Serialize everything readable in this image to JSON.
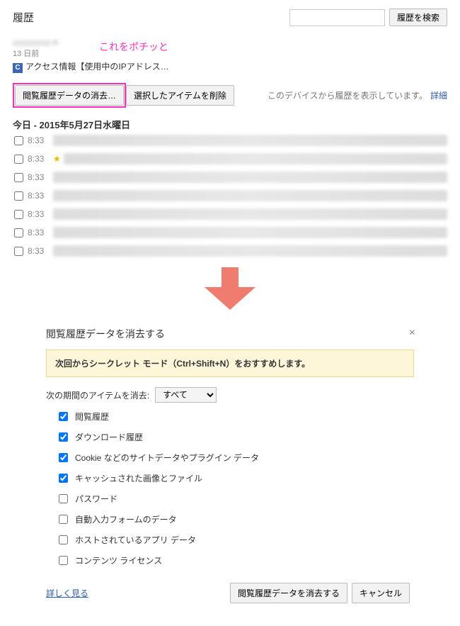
{
  "header": {
    "title": "履歴",
    "search_button": "履歴を検索",
    "search_placeholder": ""
  },
  "annot": {
    "click_this": "これをポチッと"
  },
  "user": {
    "age": "13 日前",
    "access": "アクセス情報【使用中のIPアドレス…",
    "badge": "C"
  },
  "toolbar": {
    "clear": "閲覧履歴データの消去…",
    "delete_selected": "選択したアイテムを削除",
    "device_text": "このデバイスから履歴を表示しています。",
    "details": "詳細"
  },
  "date": "今日 - 2015年5月27日水曜日",
  "history": [
    {
      "time": "8:33",
      "star": false
    },
    {
      "time": "8:33",
      "star": true
    },
    {
      "time": "8:33",
      "star": false
    },
    {
      "time": "8:33",
      "star": false
    },
    {
      "time": "8:33",
      "star": false
    },
    {
      "time": "8:33",
      "star": false
    },
    {
      "time": "8:33",
      "star": false
    }
  ],
  "dialog": {
    "title": "閲覧履歴データを消去する",
    "banner": "次回からシークレット モード（Ctrl+Shift+N）をおすすめします。",
    "period_label": "次の期間のアイテムを消去:",
    "period_selected": "すべて",
    "items": [
      {
        "label": "閲覧履歴",
        "checked": true
      },
      {
        "label": "ダウンロード履歴",
        "checked": true
      },
      {
        "label": "Cookie などのサイトデータやプラグイン データ",
        "checked": true
      },
      {
        "label": "キャッシュされた画像とファイル",
        "checked": true
      },
      {
        "label": "パスワード",
        "checked": false
      },
      {
        "label": "自動入力フォームのデータ",
        "checked": false
      },
      {
        "label": "ホストされているアプリ データ",
        "checked": false
      },
      {
        "label": "コンテンツ ライセンス",
        "checked": false
      }
    ],
    "learn_more": "詳しく見る",
    "confirm": "閲覧履歴データを消去する",
    "cancel": "キャンセル"
  }
}
